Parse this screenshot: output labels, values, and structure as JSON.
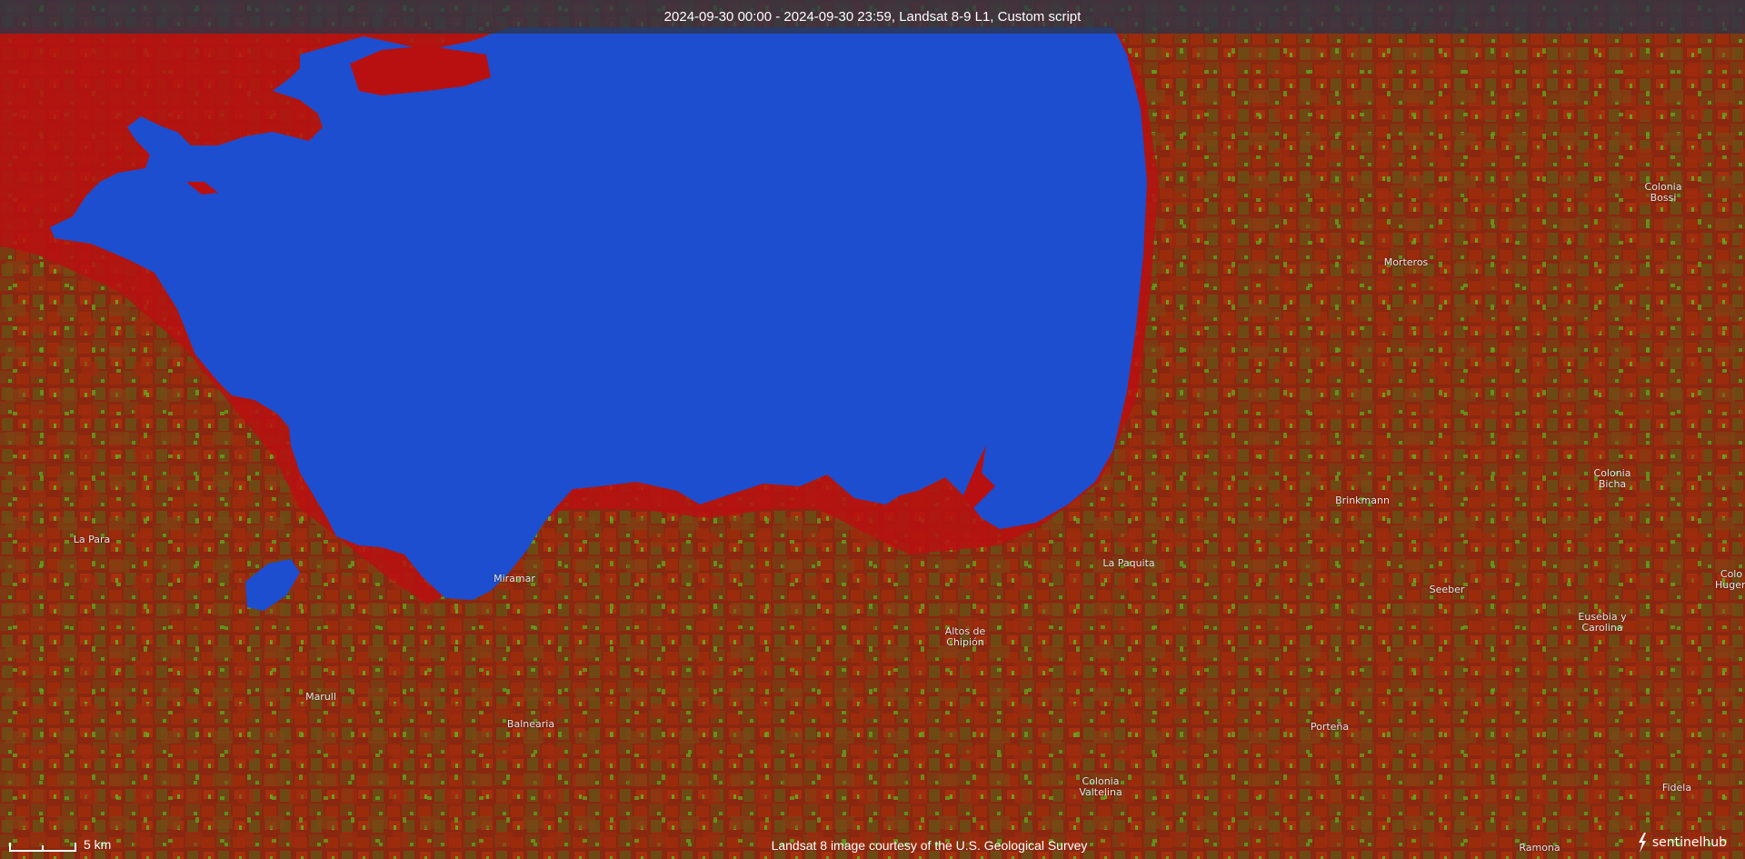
{
  "header": {
    "title": "2024-09-30 00:00 - 2024-09-30 23:59, Landsat 8-9 L1, Custom script"
  },
  "map": {
    "water_color": "#1d4ecf",
    "land_color": "#8f2410",
    "shore_color": "#b30f0f",
    "field_color": "#6b8c1e",
    "places": [
      {
        "name": "Colonia\nBossi"
      },
      {
        "name": "Morteros"
      },
      {
        "name": "Colonia\nBicha"
      },
      {
        "name": "Brinkmann"
      },
      {
        "name": "La Para"
      },
      {
        "name": "Miramar"
      },
      {
        "name": "La Paquita"
      },
      {
        "name": "Seeber"
      },
      {
        "name": "Colo\nHugen"
      },
      {
        "name": "Eusebia y\nCarolina"
      },
      {
        "name": "Altos de\nChipión"
      },
      {
        "name": "Marull"
      },
      {
        "name": "Balnearia"
      },
      {
        "name": "Porteña"
      },
      {
        "name": "Colonia\nValtelina"
      },
      {
        "name": "Fidela"
      },
      {
        "name": "Ramona"
      }
    ]
  },
  "scale": {
    "label": "5 km"
  },
  "attribution": "Landsat 8 image courtesy of the U.S. Geological Survey",
  "logo": {
    "text": "sentinelhub",
    "icon": "sentinelhub-logo-icon"
  }
}
